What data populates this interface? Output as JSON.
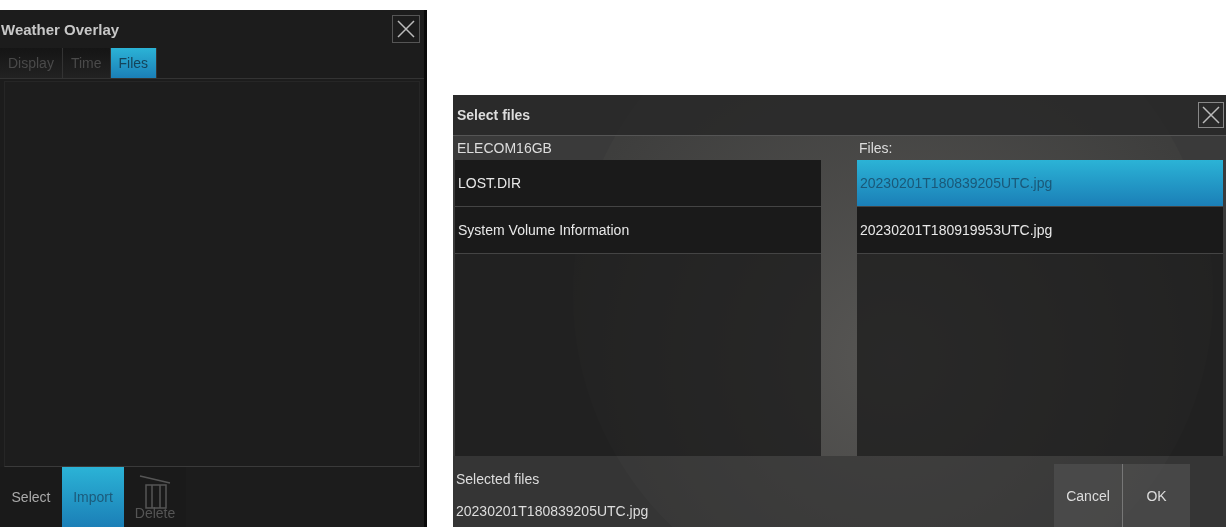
{
  "weather_overlay": {
    "title": "Weather Overlay",
    "tabs": [
      {
        "label": "Display",
        "selected": false
      },
      {
        "label": "Time",
        "selected": false
      },
      {
        "label": "Files",
        "selected": true
      }
    ],
    "toolbar": [
      {
        "kind": "text",
        "label": "Select",
        "selected": false,
        "disabled": false
      },
      {
        "kind": "text",
        "label": "Import",
        "selected": true,
        "disabled": false
      },
      {
        "kind": "trash",
        "label": "Delete",
        "selected": false,
        "disabled": true
      }
    ]
  },
  "select_files": {
    "title": "Select files",
    "drive": "ELECOM16GB",
    "folders": [
      {
        "name": "LOST.DIR",
        "selected": false
      },
      {
        "name": "System Volume Information",
        "selected": false
      }
    ],
    "files_label": "Files:",
    "files": [
      {
        "name": "20230201T180839205UTC.jpg",
        "selected": true
      },
      {
        "name": "20230201T180919953UTC.jpg",
        "selected": false
      }
    ],
    "selected_label": "Selected files",
    "selected_file": "20230201T180839205UTC.jpg",
    "buttons": [
      "Cancel",
      "OK"
    ]
  }
}
